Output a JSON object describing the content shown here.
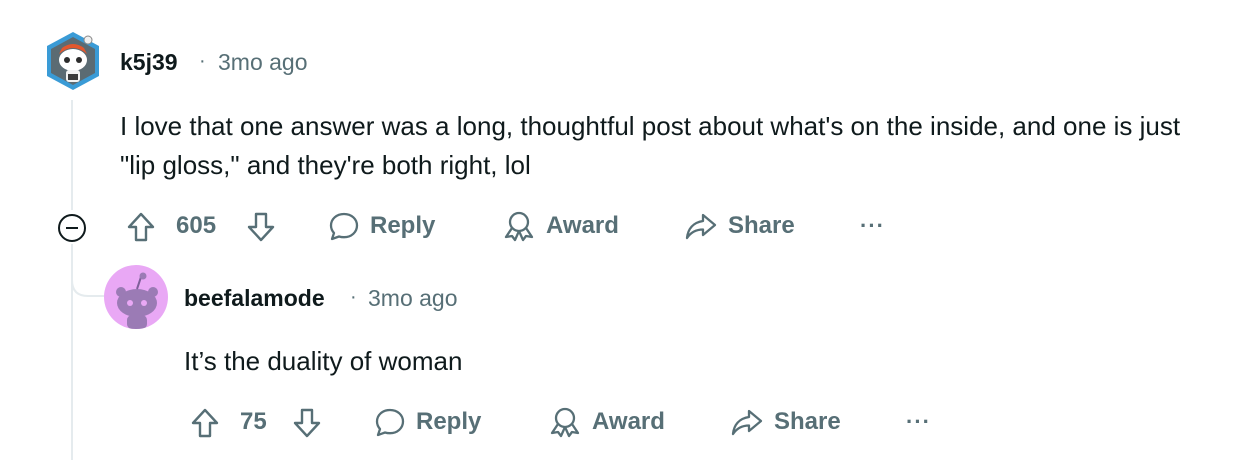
{
  "comments": [
    {
      "username": "k5j39",
      "separator": "·",
      "time": "3mo ago",
      "text": "I love that one answer was a long, thoughtful post about what's on the inside, and one is just \"lip gloss,\" and they're both right, lol",
      "votes": "605",
      "reply_label": "Reply",
      "award_label": "Award",
      "share_label": "Share",
      "more_label": "···"
    },
    {
      "username": "beefalamode",
      "separator": "·",
      "time": "3mo ago",
      "text": "It’s the duality of woman",
      "votes": "75",
      "reply_label": "Reply",
      "award_label": "Award",
      "share_label": "Share",
      "more_label": "···"
    }
  ],
  "icons": {
    "collapse": "minus-circle-icon",
    "upvote": "arrow-up-icon",
    "downvote": "arrow-down-icon",
    "reply": "speech-bubble-icon",
    "award": "award-ribbon-icon",
    "share": "share-arrow-icon"
  },
  "colors": {
    "text": "#0f1a1c",
    "meta": "#576f76",
    "thread_line": "#e5ebee",
    "avatar2_bg": "#e9a8f5"
  }
}
